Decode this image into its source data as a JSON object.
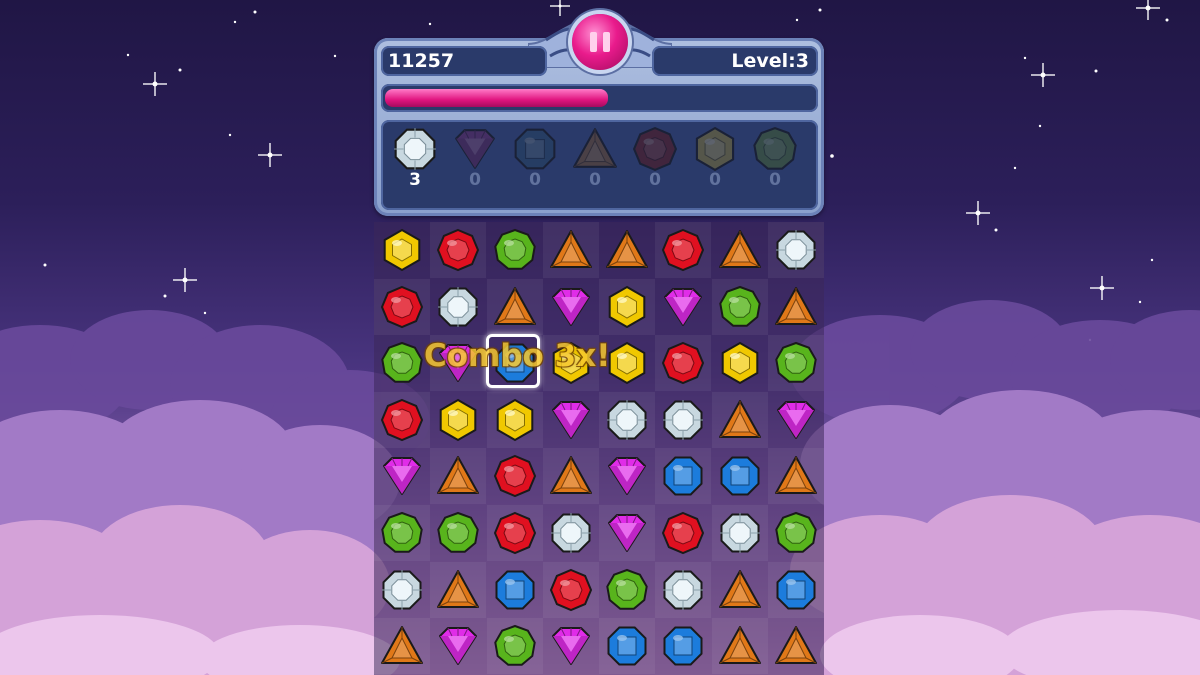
{
  "hud": {
    "score": "11257",
    "level": "Level:3",
    "progress": 0.52,
    "pause_icon": "pause-icon",
    "collect": [
      {
        "gem": "white",
        "count": "3",
        "active": true
      },
      {
        "gem": "purple",
        "count": "0",
        "active": false
      },
      {
        "gem": "blue",
        "count": "0",
        "active": false
      },
      {
        "gem": "orange",
        "count": "0",
        "active": false
      },
      {
        "gem": "red",
        "count": "0",
        "active": false
      },
      {
        "gem": "yellow",
        "count": "0",
        "active": false
      },
      {
        "gem": "green",
        "count": "0",
        "active": false
      }
    ]
  },
  "board": {
    "combo_text": "Combo 3x!",
    "selected": {
      "row": 3,
      "col": 3
    },
    "rows": [
      [
        "yellow",
        "red",
        "green",
        "orange",
        "orange",
        "red",
        "orange",
        "white"
      ],
      [
        "red",
        "white",
        "orange",
        "purple",
        "yellow",
        "purple",
        "green",
        "orange"
      ],
      [
        "green",
        "purple",
        "blue",
        "yellow",
        "yellow",
        "red",
        "yellow",
        "green"
      ],
      [
        "red",
        "yellow",
        "yellow",
        "purple",
        "white",
        "white",
        "orange",
        "purple"
      ],
      [
        "purple",
        "orange",
        "red",
        "orange",
        "purple",
        "blue",
        "blue",
        "orange"
      ],
      [
        "green",
        "green",
        "red",
        "white",
        "purple",
        "red",
        "white",
        "green"
      ],
      [
        "white",
        "orange",
        "blue",
        "red",
        "green",
        "white",
        "orange",
        "blue"
      ],
      [
        "orange",
        "purple",
        "green",
        "purple",
        "blue",
        "blue",
        "orange",
        "orange"
      ]
    ]
  },
  "colors": {
    "red": "#e01020",
    "yellow": "#f0c800",
    "green": "#58b41c",
    "orange": "#e07818",
    "white": "#c8d8e0",
    "purple": "#e02ce8",
    "blue": "#1c7cdc",
    "accent": "#e91b8c"
  }
}
